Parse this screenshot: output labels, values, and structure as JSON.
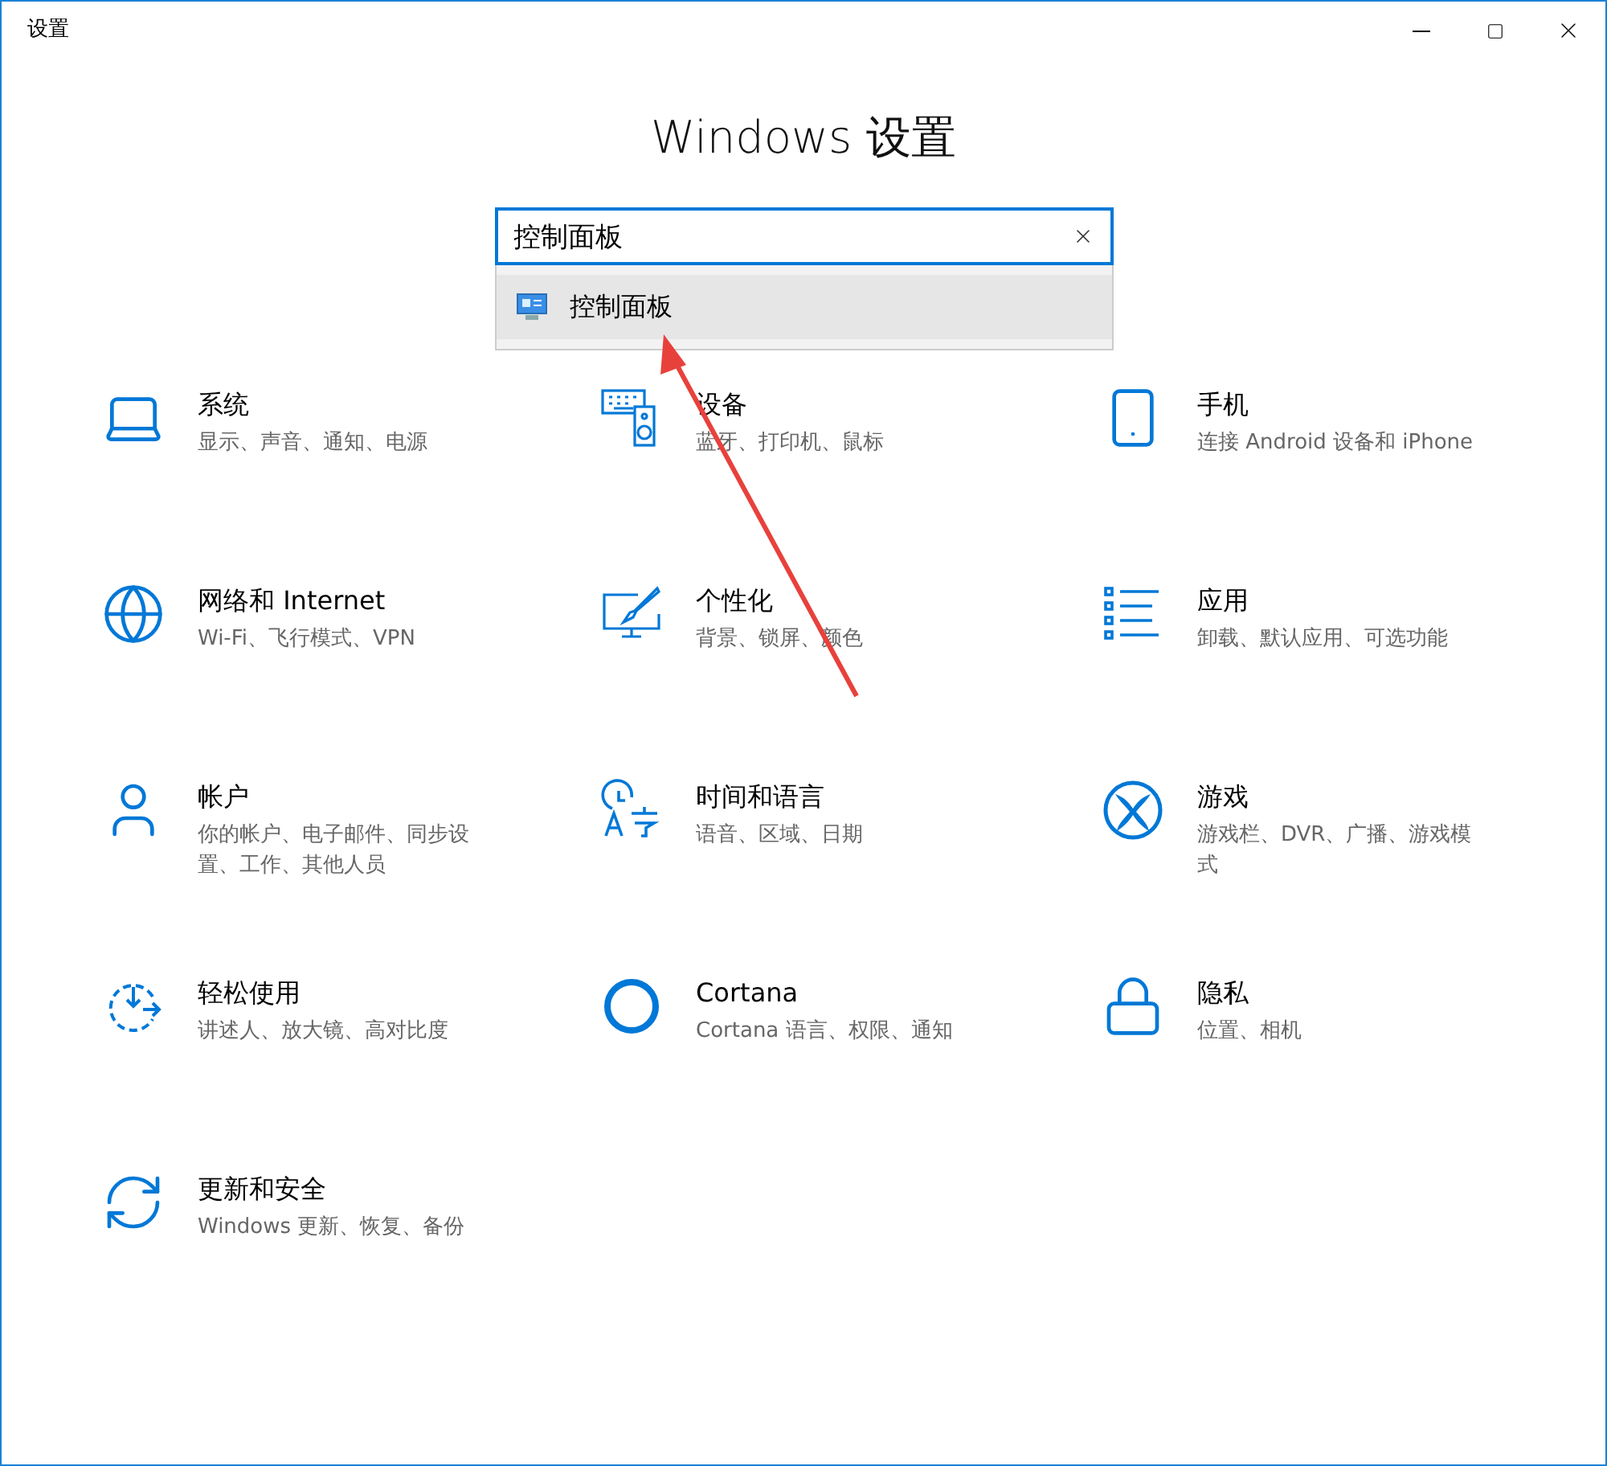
{
  "window": {
    "title": "设置"
  },
  "heading": "Windows 设置",
  "search": {
    "value": "控制面板"
  },
  "suggestions": [
    {
      "label": "控制面板",
      "selected": true
    }
  ],
  "categories": [
    {
      "title": "系统",
      "description": "显示、声音、通知、电源"
    },
    {
      "title": "设备",
      "description": "蓝牙、打印机、鼠标"
    },
    {
      "title": "手机",
      "description": "连接 Android 设备和 iPhone"
    },
    {
      "title": "网络和 Internet",
      "description": "Wi-Fi、飞行模式、VPN"
    },
    {
      "title": "个性化",
      "description": "背景、锁屏、颜色"
    },
    {
      "title": "应用",
      "description": "卸载、默认应用、可选功能"
    },
    {
      "title": "帐户",
      "description": "你的帐户、电子邮件、同步设置、工作、其他人员"
    },
    {
      "title": "时间和语言",
      "description": "语音、区域、日期"
    },
    {
      "title": "游戏",
      "description": "游戏栏、DVR、广播、游戏模式"
    },
    {
      "title": "轻松使用",
      "description": "讲述人、放大镜、高对比度"
    },
    {
      "title": "Cortana",
      "description": "Cortana 语言、权限、通知"
    },
    {
      "title": "隐私",
      "description": "位置、相机"
    },
    {
      "title": "更新和安全",
      "description": "Windows 更新、恢复、备份"
    }
  ]
}
